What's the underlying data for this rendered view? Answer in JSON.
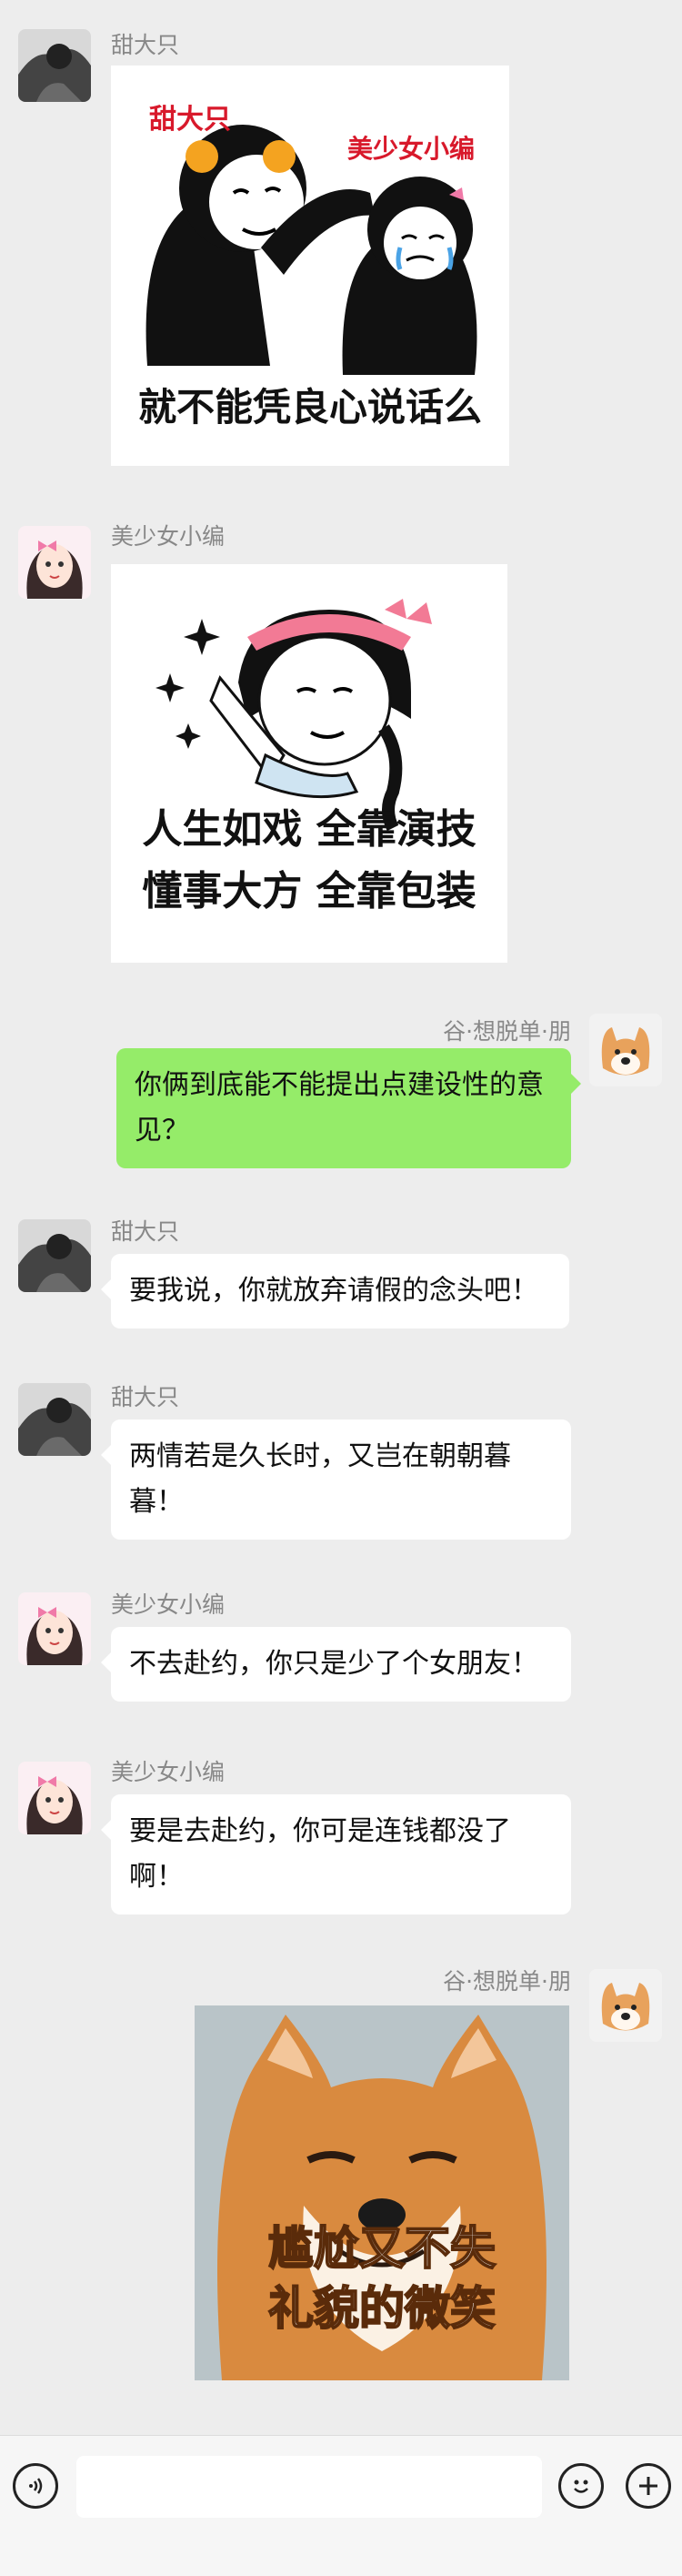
{
  "messages": [
    {
      "sender": "甜大只",
      "type": "sticker",
      "sticker": {
        "tag1": "甜大只",
        "tag2": "美少女小编",
        "caption": "就不能凭良心说话么"
      }
    },
    {
      "sender": "美少女小编",
      "type": "sticker",
      "sticker": {
        "line1": "人生如戏 全靠演技",
        "line2": "懂事大方 全靠包装"
      }
    },
    {
      "sender": "谷·想脱单·朋",
      "type": "text",
      "text": "你俩到底能不能提出点建设性的意见？"
    },
    {
      "sender": "甜大只",
      "type": "text",
      "text": "要我说，你就放弃请假的念头吧！"
    },
    {
      "sender": "甜大只",
      "type": "text",
      "text": "两情若是久长时，又岂在朝朝暮暮！"
    },
    {
      "sender": "美少女小编",
      "type": "text",
      "text": "不去赴约，你只是少了个女朋友！"
    },
    {
      "sender": "美少女小编",
      "type": "text",
      "text": "要是去赴约，你可是连钱都没了啊！"
    },
    {
      "sender": "谷·想脱单·朋",
      "type": "sticker",
      "sticker": {
        "line1": "尴尬又不失",
        "line2": "礼貌的微笑"
      }
    }
  ],
  "input_bar": {
    "icons": [
      "voice-icon",
      "emoji-icon",
      "plus-icon"
    ]
  }
}
